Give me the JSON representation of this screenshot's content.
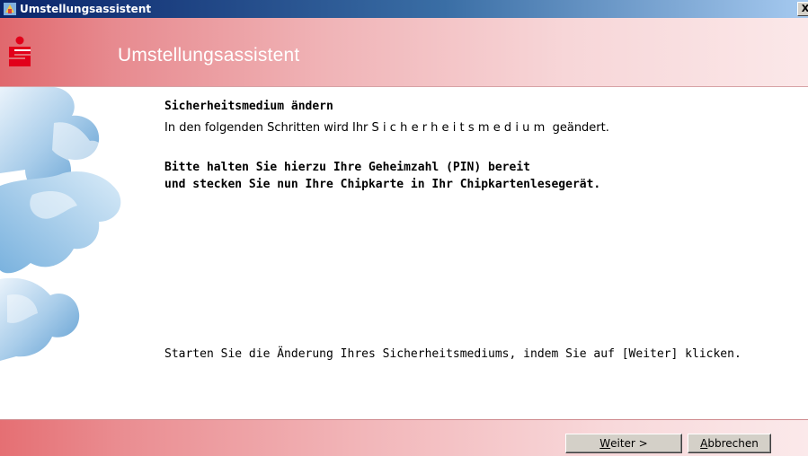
{
  "window": {
    "title": "Umstellungsassistent",
    "close_glyph": "X"
  },
  "header": {
    "title": "Umstellungsassistent",
    "logo_icon": "sparkasse-logo-icon",
    "accent_color": "#e0686d"
  },
  "content": {
    "section_title": "Sicherheitsmedium ändern",
    "intro_prefix": "In den folgenden Schritten wird Ihr ",
    "intro_emphasis": "Sicherheitsmedium",
    "intro_suffix": " geändert.",
    "instruction_line_1": "Bitte halten Sie hierzu Ihre Geheimzahl (PIN) bereit",
    "instruction_line_2": "und stecken Sie nun Ihre Chipkarte in Ihr Chipkartenlesegerät.",
    "start_hint": "Starten Sie die Änderung Ihres Sicherheitsmediums, indem Sie auf [Weiter] klicken."
  },
  "footer": {
    "next_mnemonic": "W",
    "next_rest": "eiter >",
    "cancel_mnemonic": "A",
    "cancel_rest": "bbrechen"
  }
}
